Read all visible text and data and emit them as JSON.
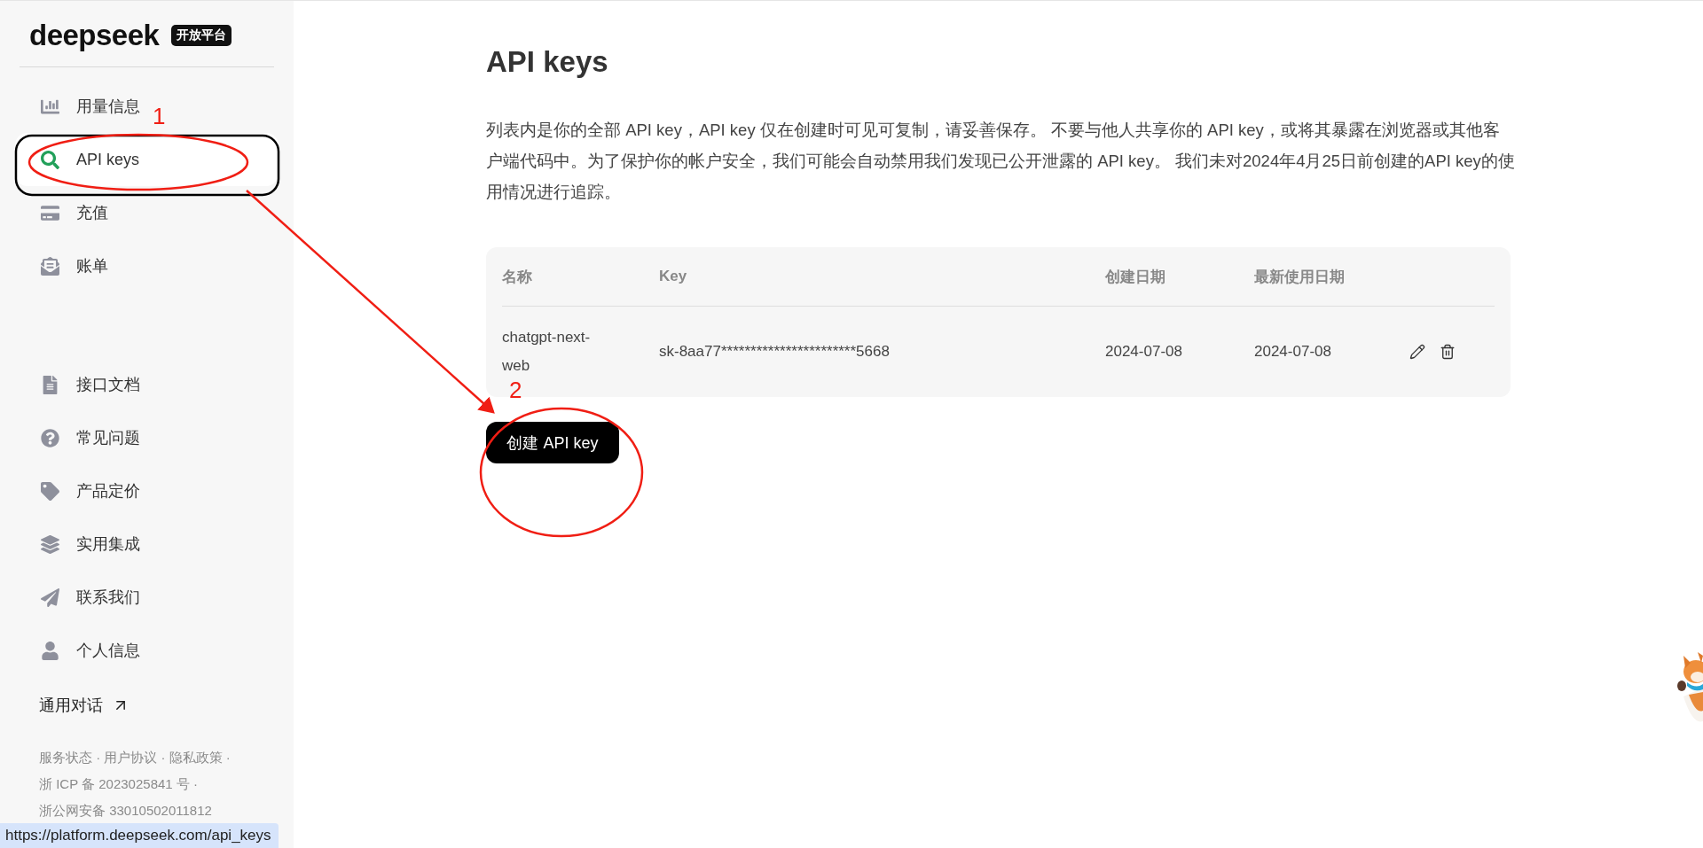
{
  "sidebar": {
    "logo": "deepseek",
    "badge": "开放平台",
    "items": [
      {
        "label": "用量信息",
        "kind": "chart",
        "selected": false
      },
      {
        "label": "API keys",
        "kind": "search",
        "selected": true
      },
      {
        "label": "充值",
        "kind": "card",
        "selected": false
      },
      {
        "label": "账单",
        "kind": "envelope",
        "selected": false
      }
    ],
    "lower_items": [
      {
        "label": "接口文档",
        "kind": "document",
        "selected": false
      },
      {
        "label": "常见问题",
        "kind": "help",
        "selected": false
      },
      {
        "label": "产品定价",
        "kind": "tag",
        "selected": false
      },
      {
        "label": "实用集成",
        "kind": "layers",
        "selected": false
      },
      {
        "label": "联系我们",
        "kind": "plane",
        "selected": false
      },
      {
        "label": "个人信息",
        "kind": "user",
        "selected": false
      }
    ],
    "chat_link": "通用对话",
    "footer": [
      "服务状态 · 用户协议 · 隐私政策 ·",
      "浙 ICP 备 2023025841 号 ·",
      "浙公网安备 33010502011812"
    ]
  },
  "main": {
    "title": "API keys",
    "description": "列表内是你的全部 API key，API key 仅在创建时可见可复制，请妥善保存。 不要与他人共享你的 API key，或将其暴露在浏览器或其他客户端代码中。为了保护你的帐户安全，我们可能会自动禁用我们发现已公开泄露的 API key。 我们未对2024年4月25日前创建的API key的使用情况进行追踪。",
    "table": {
      "columns": [
        "名称",
        "Key",
        "创建日期",
        "最新使用日期"
      ],
      "rows": [
        {
          "cells": [
            "chatgpt-next-web",
            "sk-8aa77***********************5668",
            "2024-07-08",
            "2024-07-08"
          ]
        }
      ]
    },
    "create_button": "创建 API key"
  },
  "annotations": {
    "marks": [
      "1",
      "2"
    ]
  },
  "status_url": "https://platform.deepseek.com/api_keys"
}
